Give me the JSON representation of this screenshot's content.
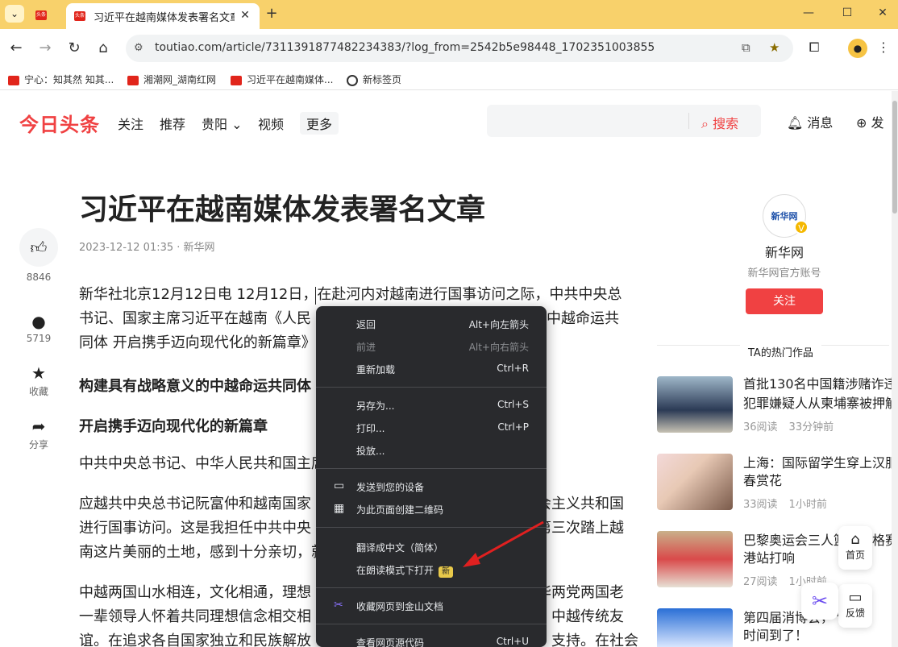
{
  "browser": {
    "active_tab_title": "习近平在越南媒体发表署名文章",
    "favicon_text": "头条",
    "new_tab_symbol": "+",
    "url": "toutiao.com/article/7311391877482234383/?log_from=2542b5e98448_1702351003855",
    "bookmarks": [
      {
        "label": "宁心：知其然 知其..."
      },
      {
        "label": "湘潮网_湖南红网"
      },
      {
        "label": "习近平在越南媒体..."
      },
      {
        "label": "新标签页"
      }
    ]
  },
  "site": {
    "logo": "今日头条",
    "nav": [
      "关注",
      "推荐",
      "贵阳",
      "视频",
      "更多"
    ],
    "search_button": "搜索",
    "messages": "消息",
    "publish": "发"
  },
  "article": {
    "title": "习近平在越南媒体发表署名文章",
    "meta": "2023-12-12 01:35 · 新华网",
    "paragraphs": [
      "新华社北京12月12日电 12月12日，在赴河内对越南进行国事访问之际，中共中央总",
      "书记、国家主席习近平在越南《人民",
      "同体 开启携手迈向现代化的新篇章》",
      "中越命运共"
    ],
    "heading1": "构建具有战略意义的中越命运共同体",
    "heading2": "开启携手迈向现代化的新篇章",
    "para2": "中共中央总书记、中华人民共和国主席",
    "para3_lines": [
      "应越共中央总书记阮富仲和越南国家",
      "进行国事访问。这是我担任中共中央",
      "南这片美丽的土地，感到十分亲切，就"
    ],
    "para3_right": [
      "会主义共和国",
      "第三次踏上越"
    ],
    "para4_lines": [
      "中越两国山水相连，文化相通，理想",
      "一辈领导人怀着共同理想信念相交相",
      "谊。在追求各自国家独立和民族解放"
    ],
    "para4_right": [
      "华两党两国老",
      "中越传统友",
      "支持。在社会"
    ]
  },
  "side_actions": [
    {
      "label": "8846"
    },
    {
      "label": "5719"
    },
    {
      "label": "收藏"
    },
    {
      "label": "分享"
    }
  ],
  "author": {
    "name": "新华网",
    "desc": "新华网官方账号",
    "follow": "关注",
    "logo_text": "新华网",
    "hot_header": "TA的热门作品"
  },
  "hot_items": [
    {
      "title": "首批130名中国籍涉赌诈违",
      "title2": "犯罪嫌疑人从柬埔寨被押解",
      "reads": "36阅读",
      "time": "33分钟前"
    },
    {
      "title": "上海：国际留学生穿上汉服",
      "title2": "春赏花",
      "reads": "33阅读",
      "time": "1小时前"
    },
    {
      "title": "巴黎奥运会三人篮球资格赛",
      "title2": "港站打响",
      "reads": "27阅读",
      "time": "1小时前"
    },
    {
      "title": "第四届消博会，\"种",
      "title2": "时间到了！",
      "reads": "",
      "time": ""
    }
  ],
  "float": {
    "home": "首页",
    "feedback": "反馈"
  },
  "context_menu": {
    "back": "返回",
    "back_sc": "Alt+向左箭头",
    "forward": "前进",
    "forward_sc": "Alt+向右箭头",
    "reload": "重新加载",
    "reload_sc": "Ctrl+R",
    "save_as": "另存为...",
    "save_as_sc": "Ctrl+S",
    "print": "打印...",
    "print_sc": "Ctrl+P",
    "cast": "投放...",
    "send_device": "发送到您的设备",
    "qr": "为此页面创建二维码",
    "translate": "翻译成中文（简体）",
    "reading_mode": "在朗读模式下打开",
    "new_badge": "新",
    "jinshan": "收藏网页到金山文档",
    "view_source": "查看网页源代码",
    "view_source_sc": "Ctrl+U"
  },
  "colors": {
    "brand_red": "#f04142",
    "tab_strip": "#f8d16b",
    "menu_bg": "#292a2d",
    "arrow": "#e02020"
  }
}
